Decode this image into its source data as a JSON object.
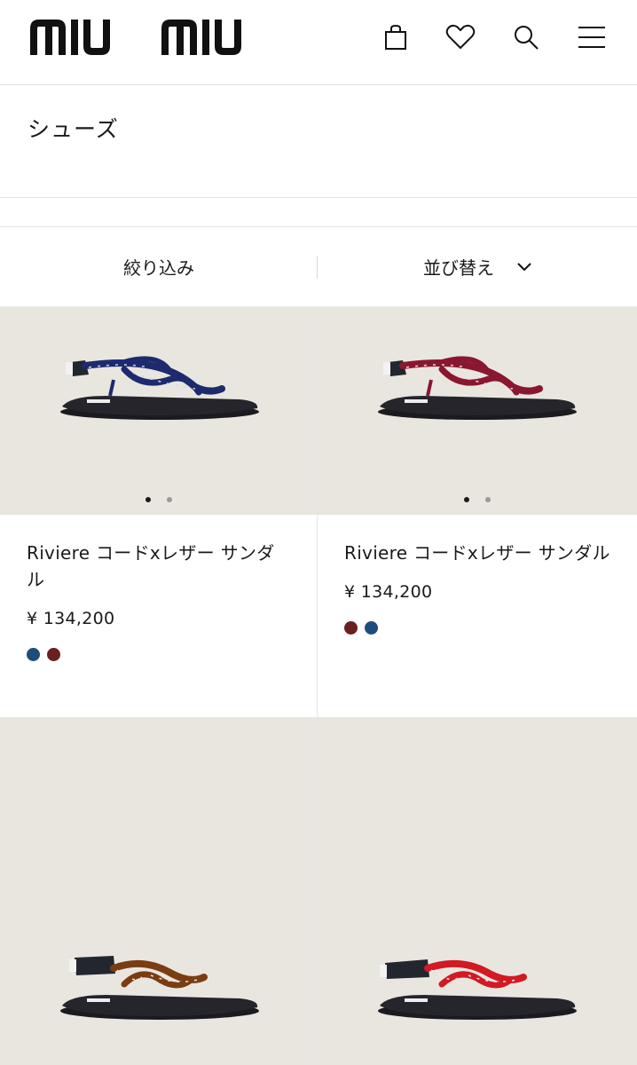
{
  "header": {
    "logo_text": "miu miu",
    "icons": [
      "shopping-bag-icon",
      "heart-icon",
      "search-icon",
      "menu-icon"
    ]
  },
  "page": {
    "title": "シューズ"
  },
  "toolbar": {
    "filter_label": "絞り込み",
    "sort_label": "並び替え"
  },
  "products": [
    {
      "name": "Riviere コードxレザー サンダル",
      "price": "¥ 134,200",
      "swatches": [
        "#1f4d7a",
        "#6b1f1f"
      ],
      "strap_color": "#1e2a6e",
      "image_dots": 2,
      "active_dot": 0
    },
    {
      "name": "Riviere コードxレザー サンダル",
      "price": "¥ 134,200",
      "swatches": [
        "#6b1f1f",
        "#1f4d7a"
      ],
      "strap_color": "#8a1730",
      "image_dots": 2,
      "active_dot": 0
    },
    {
      "strap_color": "#7a3d12"
    },
    {
      "strap_color": "#d11a22"
    }
  ],
  "colors": {
    "accent": "#1a1a1a",
    "image_bg": "#e9e6e0",
    "divider": "#e2e2e2"
  }
}
